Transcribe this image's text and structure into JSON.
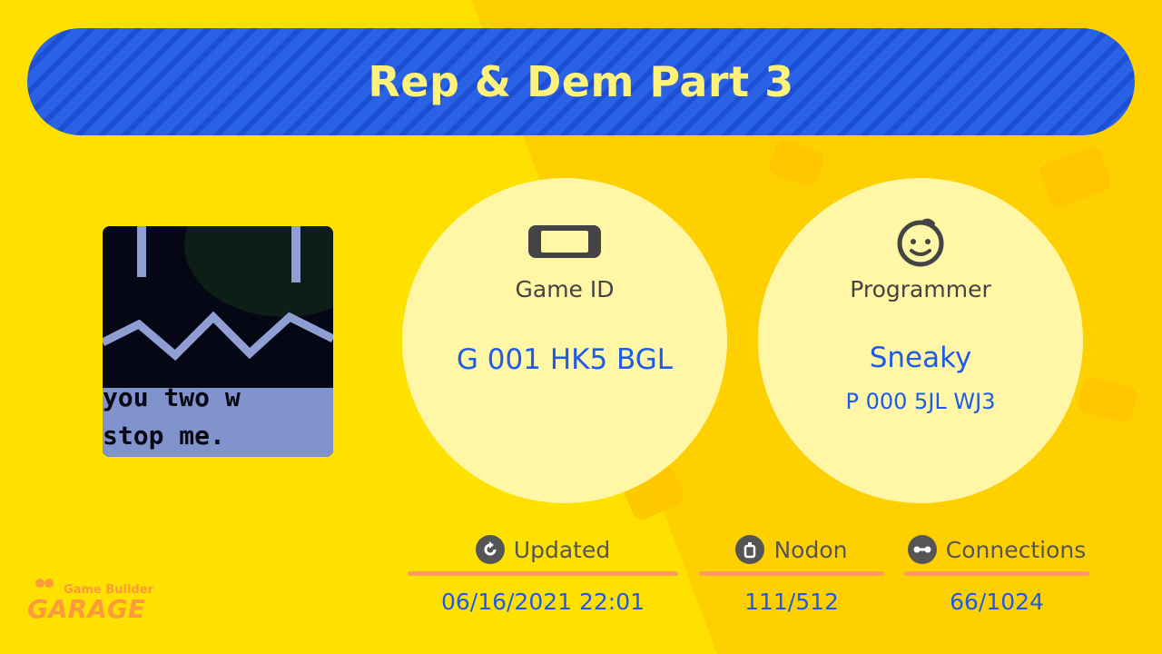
{
  "title": "Rep & Dem Part 3",
  "thumbnail": {
    "text_line_1": "you two w",
    "text_line_2": "stop me."
  },
  "game_id": {
    "icon": "console-icon",
    "label": "Game ID",
    "value": "G 001 HK5 BGL"
  },
  "programmer": {
    "icon": "face-icon",
    "label": "Programmer",
    "name": "Sneaky",
    "id": "P 000 5JL WJ3"
  },
  "stats": {
    "updated": {
      "icon": "refresh-icon",
      "label": "Updated",
      "value": "06/16/2021 22:01"
    },
    "nodon": {
      "icon": "nodon-icon",
      "label": "Nodon",
      "value": "111/512"
    },
    "connections": {
      "icon": "connection-icon",
      "label": "Connections",
      "value": "66/1024"
    }
  },
  "logo": {
    "line_1": "Game Builder",
    "line_2": "GARAGE"
  },
  "colors": {
    "background": "#ffe100",
    "title_bar": "#2a62e6",
    "title_text": "#fff27a",
    "circle": "#fff6a6",
    "value_text": "#1e5be8",
    "accent_line": "#ff9960",
    "logo": "#ff9a3c"
  }
}
